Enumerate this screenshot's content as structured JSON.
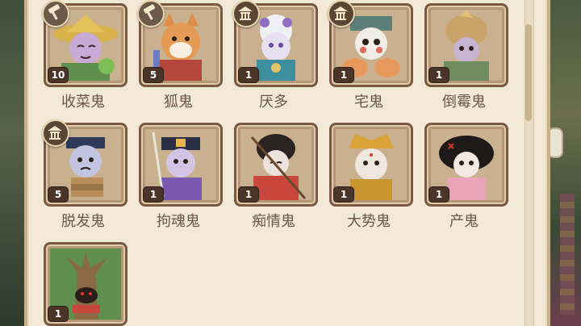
{
  "ghosts": [
    {
      "name": "收菜鬼",
      "level": "10",
      "badge": "hammer-icon"
    },
    {
      "name": "狐鬼",
      "level": "5",
      "badge": "hammer-icon"
    },
    {
      "name": "厌多",
      "level": "1",
      "badge": "pavilion-icon"
    },
    {
      "name": "宅鬼",
      "level": "1",
      "badge": "pavilion-icon"
    },
    {
      "name": "倒霉鬼",
      "level": "1",
      "badge": ""
    },
    {
      "name": "脱发鬼",
      "level": "5",
      "badge": "pavilion-icon"
    },
    {
      "name": "拘魂鬼",
      "level": "1",
      "badge": ""
    },
    {
      "name": "痴情鬼",
      "level": "1",
      "badge": ""
    },
    {
      "name": "大势鬼",
      "level": "1",
      "badge": ""
    },
    {
      "name": "产鬼",
      "level": "1",
      "badge": ""
    },
    {
      "name": "",
      "level": "1",
      "badge": ""
    }
  ],
  "colors": {
    "panel": "#f2ead7",
    "card_border": "#7b5a43",
    "name_text": "#6a5645",
    "level_badge": "#4a3528"
  }
}
